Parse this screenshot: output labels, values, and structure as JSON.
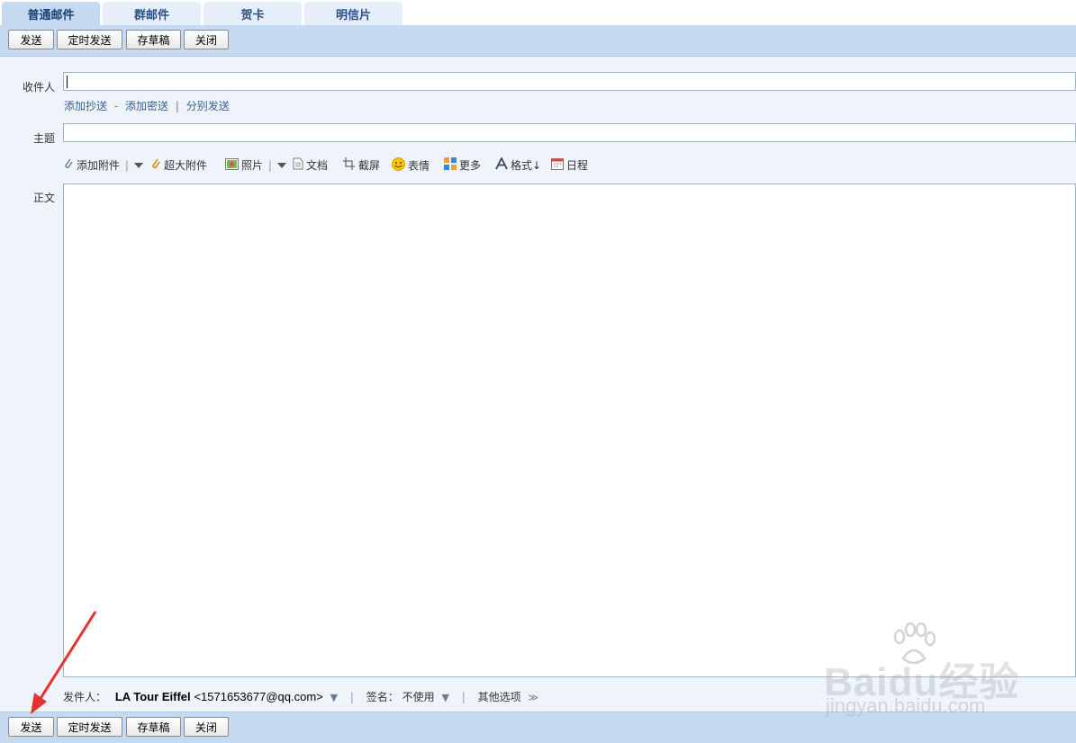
{
  "tabs": [
    {
      "label": "普通邮件",
      "active": true
    },
    {
      "label": "群邮件"
    },
    {
      "label": "贺卡"
    },
    {
      "label": "明信片"
    }
  ],
  "toolbar": {
    "send": "发送",
    "scheduled_send": "定时发送",
    "save_draft": "存草稿",
    "close": "关闭"
  },
  "form": {
    "to_label": "收件人",
    "to_value": "",
    "add_cc": "添加抄送",
    "dash": "-",
    "add_bcc": "添加密送",
    "pipe": "|",
    "split_send": "分别发送",
    "subject_label": "主题",
    "subject_value": "",
    "body_label": "正文",
    "body_value": ""
  },
  "attach_bar": {
    "add_attachment": "添加附件",
    "large_attachment": "超大附件",
    "photo": "照片",
    "document": "文档",
    "screenshot": "截屏",
    "emoji": "表情",
    "more": "更多",
    "format": "格式↓",
    "schedule": "日程"
  },
  "sender": {
    "label": "发件人：",
    "name": "LA Tour Eiffel",
    "email": "<1571653677@qq.com>",
    "signature_label": "签名：",
    "signature_value": "不使用",
    "other_options": "其他选项",
    "sep": "|"
  },
  "watermark": {
    "brand": "Baidu经验",
    "domain": "jingyan.baidu.com"
  },
  "colors": {
    "tab_text": "#2b4f86",
    "toolbar_bg": "#c5d9f1",
    "compose_bg": "#eff4fb",
    "link": "#3a5f8f",
    "annotation_arrow": "#e5322d"
  }
}
